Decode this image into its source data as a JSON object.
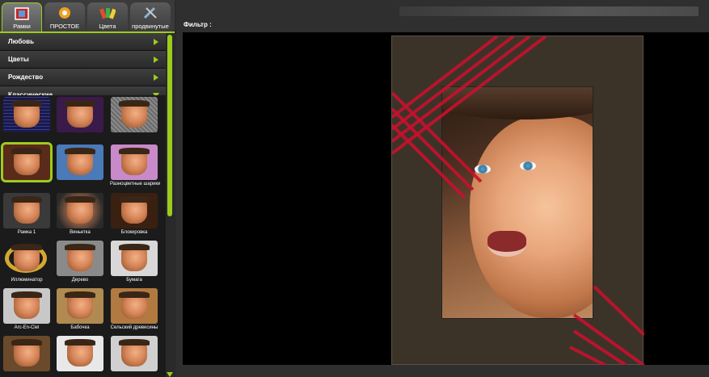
{
  "tabs": [
    {
      "label": "Рамки",
      "icon": "frames-icon",
      "active": true
    },
    {
      "label": "ПРОСТОЕ",
      "icon": "simple-effects-icon",
      "active": false
    },
    {
      "label": "Цвета",
      "icon": "colors-icon",
      "active": false
    },
    {
      "label": "продвинутые",
      "icon": "advanced-tools-icon",
      "active": false
    }
  ],
  "categories": [
    {
      "label": "Любовь",
      "state": "collapsed"
    },
    {
      "label": "Цветы",
      "state": "collapsed"
    },
    {
      "label": "Рождество",
      "state": "collapsed"
    },
    {
      "label": "Классические",
      "state": "expanded"
    }
  ],
  "thumbnails": [
    {
      "label": "",
      "style": "blue-grid"
    },
    {
      "label": "",
      "style": "purple"
    },
    {
      "label": "",
      "style": "grey-pattern"
    },
    {
      "label": "",
      "style": "brown-red",
      "selected": true
    },
    {
      "label": "",
      "style": "blue"
    },
    {
      "label": "Разноцветные шарики",
      "style": "pink"
    },
    {
      "label": "Рамка 1",
      "style": "dark-rounded"
    },
    {
      "label": "Виньетка",
      "style": "vignette"
    },
    {
      "label": "Блокировка",
      "style": "wood-dark"
    },
    {
      "label": "Иллюминатор",
      "style": "gold-oval"
    },
    {
      "label": "Дерево",
      "style": "grey"
    },
    {
      "label": "Бумага",
      "style": "light"
    },
    {
      "label": "Arc-En-Ciel",
      "style": "rainbow"
    },
    {
      "label": "Бабочка",
      "style": "butterfly"
    },
    {
      "label": "Сельский древесины",
      "style": "rustic-wood"
    },
    {
      "label": "",
      "style": "dark-wood"
    },
    {
      "label": "",
      "style": "white-rounded"
    },
    {
      "label": "",
      "style": "white"
    }
  ],
  "main": {
    "filter_label": "Фильтр :"
  },
  "colors": {
    "accent": "#9ccc1d",
    "stripe": "#c8102e",
    "mat": "#3c3328"
  }
}
